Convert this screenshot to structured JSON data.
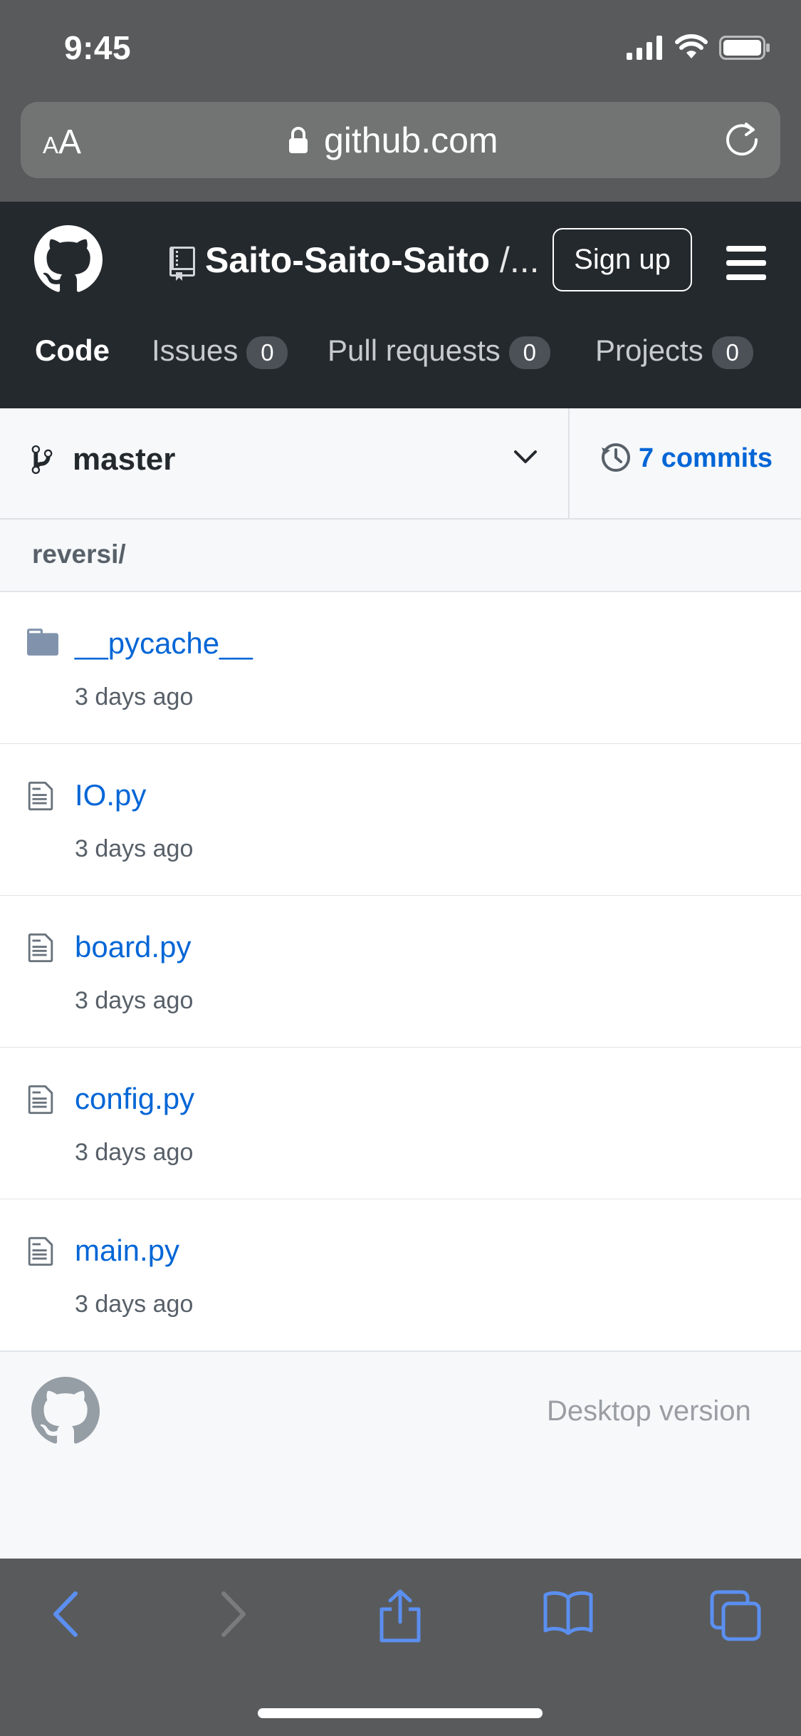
{
  "status_bar": {
    "time": "9:45"
  },
  "browser": {
    "text_size_label_small": "A",
    "text_size_label_large": "A",
    "url": "github.com"
  },
  "header": {
    "repo_owner": "Saito-Saito-Saito",
    "repo_separator": " /...",
    "signup_label": "Sign up"
  },
  "tabs": [
    {
      "label": "Code",
      "count": null
    },
    {
      "label": "Issues",
      "count": "0"
    },
    {
      "label": "Pull requests",
      "count": "0"
    },
    {
      "label": "Projects",
      "count": "0"
    }
  ],
  "branch": {
    "name": "master",
    "commits_label": "7 commits"
  },
  "path": "reversi/",
  "files": [
    {
      "name": "__pycache__",
      "age": "3 days ago",
      "type": "folder-icon"
    },
    {
      "name": "IO.py",
      "age": "3 days ago",
      "type": "file-icon"
    },
    {
      "name": "board.py",
      "age": "3 days ago",
      "type": "file-icon"
    },
    {
      "name": "config.py",
      "age": "3 days ago",
      "type": "file-icon"
    },
    {
      "name": "main.py",
      "age": "3 days ago",
      "type": "file-icon"
    }
  ],
  "footer": {
    "desktop_label": "Desktop version"
  },
  "colors": {
    "link": "#0366d6",
    "header_bg": "#24292e",
    "safari_bg": "#595a5b"
  }
}
